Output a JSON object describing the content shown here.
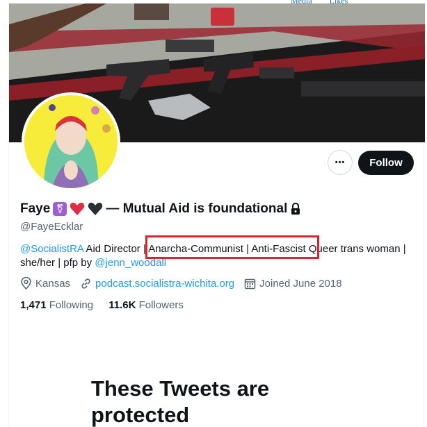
{
  "top_tabs": [
    "Media",
    "Likes"
  ],
  "profile": {
    "display_name_start": "Faye",
    "display_name_end": "— Mutual Aid is foundational",
    "handle": "@FayeEcklar",
    "bio": {
      "mention_1": "@SocialistRA",
      "text_1": " Aid Director | ",
      "highlighted": "Anarcha-Communist | Anti-Fascist",
      "text_2": " Queer trans woman | she/her | pfp by ",
      "mention_2": "@jenn_woodall"
    },
    "location": "Kansas",
    "website": "podcast.socialistra-wichita.org",
    "joined": "Joined June 2018",
    "following_count": "1,471",
    "following_label": "Following",
    "followers_count": "11.6K",
    "followers_label": "Followers"
  },
  "actions": {
    "more_label": "•••",
    "follow_label": "Follow"
  },
  "protected_heading": "These Tweets are protected",
  "icons": [
    "more-icon",
    "location-icon",
    "link-icon",
    "calendar-icon",
    "lock-icon",
    "trans-symbol-icon",
    "red-heart-icon",
    "black-heart-icon"
  ],
  "colors": {
    "accent": "#1d9bf0",
    "follow_bg": "#0f1419",
    "highlight_box": "#e0232a",
    "muted": "#536471"
  }
}
